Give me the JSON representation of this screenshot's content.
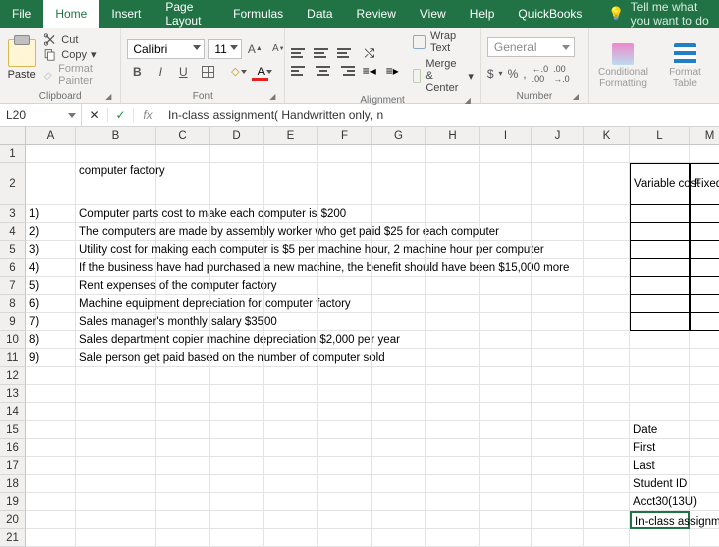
{
  "ribbon": {
    "tabs": [
      "File",
      "Home",
      "Insert",
      "Page Layout",
      "Formulas",
      "Data",
      "Review",
      "View",
      "Help",
      "QuickBooks"
    ],
    "tellme": "Tell me what you want to do",
    "clipboard": {
      "paste": "Paste",
      "cut": "Cut",
      "copy": "Copy",
      "formatPainter": "Format Painter",
      "group": "Clipboard"
    },
    "font": {
      "name": "Calibri",
      "size": "11",
      "bold": "B",
      "italic": "I",
      "underline": "U",
      "colorGlyph": "A",
      "fillGlyph": "◇",
      "group": "Font"
    },
    "alignment": {
      "wrap": "Wrap Text",
      "merge": "Merge & Center",
      "group": "Alignment"
    },
    "number": {
      "format": "General",
      "currency": "$",
      "percent": "%",
      "comma": ",",
      "incDec": "←0.00",
      "decDec": ".00→",
      "group": "Number"
    },
    "styles": {
      "cond": "Conditional Formatting",
      "table": "Format Table"
    }
  },
  "nameBox": "L20",
  "fxGlyph": "fx",
  "cancelGlyph": "✕",
  "enterGlyph": "✓",
  "formula": "In-class assignment( Handwritten only, n",
  "colHeaders": [
    "A",
    "B",
    "C",
    "D",
    "E",
    "F",
    "G",
    "H",
    "I",
    "J",
    "K",
    "L",
    "M"
  ],
  "sheet": {
    "B2": "computer factory",
    "L2": "Variable cost",
    "M2": "Fixed co",
    "A3": "1)",
    "B3": "Computer parts cost  to make each computer is $200",
    "A4": "2)",
    "B4": "The computers are made by assembly worker who get paid $25 for each computer",
    "A5": "3)",
    "B5": "Utility cost for making each computer is $5 per machine hour, 2 machine hour per computer",
    "A6": "4)",
    "B6": "If the business have had purchased a new machine, the benefit should have been $15,000 more",
    "A7": "5)",
    "B7": "Rent expenses of the computer factory",
    "A8": "6)",
    "B8": "Machine equipment depreciation for computer factory",
    "A9": "7)",
    "B9": "Sales manager's monthly salary $3500",
    "A10": "8)",
    "B10": "Sales department copier machine depreciation $2,000 per year",
    "A11": "9)",
    "B11": "Sale person get paid based on the number of computer sold",
    "L15": "Date",
    "L16": "First",
    "L17": "Last",
    "L18": "Student ID",
    "L19": "Acct30(13U)",
    "L20": "In-class assignme"
  }
}
